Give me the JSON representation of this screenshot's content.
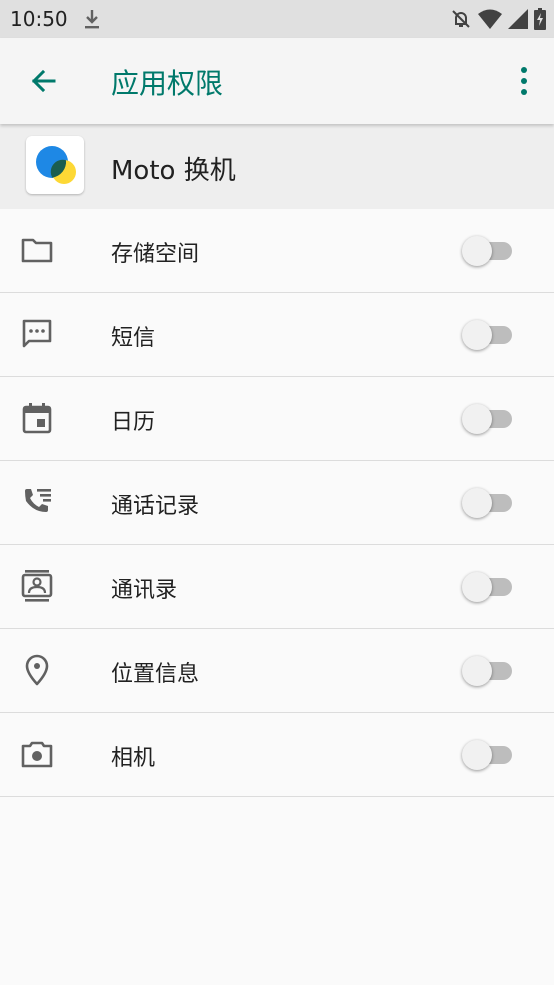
{
  "status_bar": {
    "time": "10:50",
    "icons": [
      "download-icon",
      "notifications-off-icon",
      "wifi-icon",
      "signal-icon",
      "battery-charging-icon"
    ]
  },
  "app_bar": {
    "title": "应用权限",
    "back_icon": "arrow-back-icon",
    "more_icon": "more-vert-icon"
  },
  "app": {
    "name": "Moto 换机"
  },
  "permissions": [
    {
      "label": "存储空间",
      "icon": "folder-icon",
      "enabled": false
    },
    {
      "label": "短信",
      "icon": "sms-icon",
      "enabled": false
    },
    {
      "label": "日历",
      "icon": "calendar-icon",
      "enabled": false
    },
    {
      "label": "通话记录",
      "icon": "call-log-icon",
      "enabled": false
    },
    {
      "label": "通讯录",
      "icon": "contacts-icon",
      "enabled": false
    },
    {
      "label": "位置信息",
      "icon": "location-icon",
      "enabled": false
    },
    {
      "label": "相机",
      "icon": "camera-icon",
      "enabled": false
    }
  ],
  "colors": {
    "accent": "#00796b",
    "switch_off_track": "#bdbdbd",
    "switch_off_thumb": "#f1f1f1"
  }
}
